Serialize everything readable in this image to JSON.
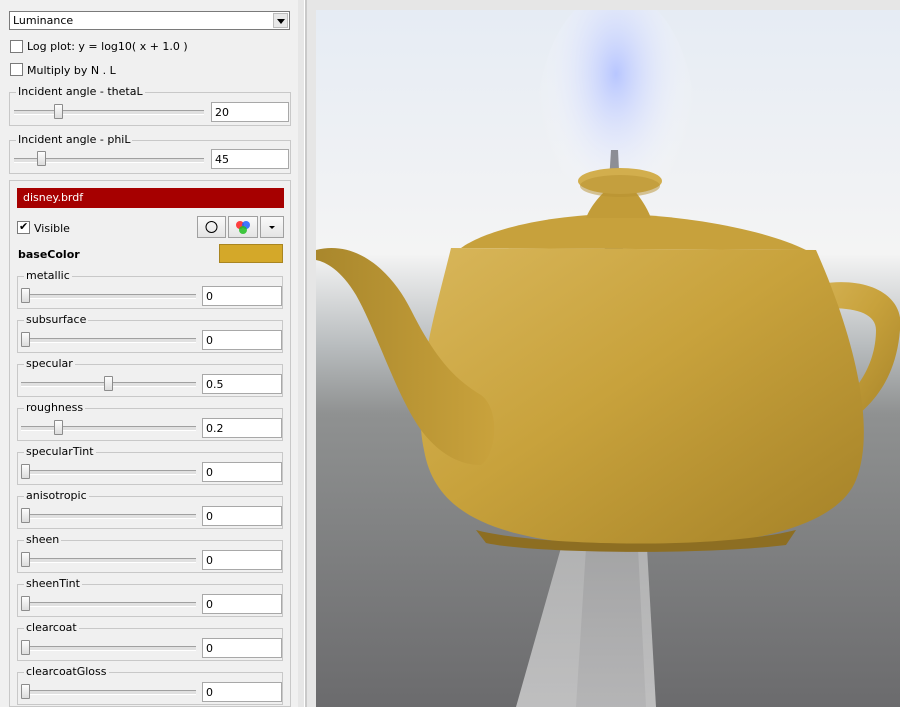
{
  "mode_select": {
    "value": "Luminance"
  },
  "log_plot": {
    "label": "Log plot:  y = log10( x + 1.0 )",
    "checked": false
  },
  "multiply_nl": {
    "label": "Multiply by N . L",
    "checked": false
  },
  "theta": {
    "label": "Incident angle - thetaL",
    "value": "20",
    "slider_fraction": 0.22
  },
  "phi": {
    "label": "Incident angle - phiL",
    "value": "45",
    "slider_fraction": 0.125
  },
  "brdf": {
    "file": "disney.brdf",
    "file_color": "#a60000",
    "visible_label": "Visible",
    "visible": true,
    "base_color_label": "baseColor",
    "base_color": "#d4a829",
    "params": [
      {
        "name": "metallic",
        "value": "0",
        "fraction": 0.0
      },
      {
        "name": "subsurface",
        "value": "0",
        "fraction": 0.0
      },
      {
        "name": "specular",
        "value": "0.5",
        "fraction": 0.5
      },
      {
        "name": "roughness",
        "value": "0.2",
        "fraction": 0.2
      },
      {
        "name": "specularTint",
        "value": "0",
        "fraction": 0.0
      },
      {
        "name": "anisotropic",
        "value": "0",
        "fraction": 0.0
      },
      {
        "name": "sheen",
        "value": "0",
        "fraction": 0.0
      },
      {
        "name": "sheenTint",
        "value": "0",
        "fraction": 0.0
      },
      {
        "name": "clearcoat",
        "value": "0",
        "fraction": 0.0
      },
      {
        "name": "clearcoatGloss",
        "value": "0",
        "fraction": 0.0
      }
    ]
  },
  "icons": {
    "solo": "circle-icon",
    "color": "rgb-circles-icon",
    "menu": "dropdown-arrow-icon"
  },
  "render": {
    "object": "teapot",
    "object_color": "#c9a23a"
  }
}
